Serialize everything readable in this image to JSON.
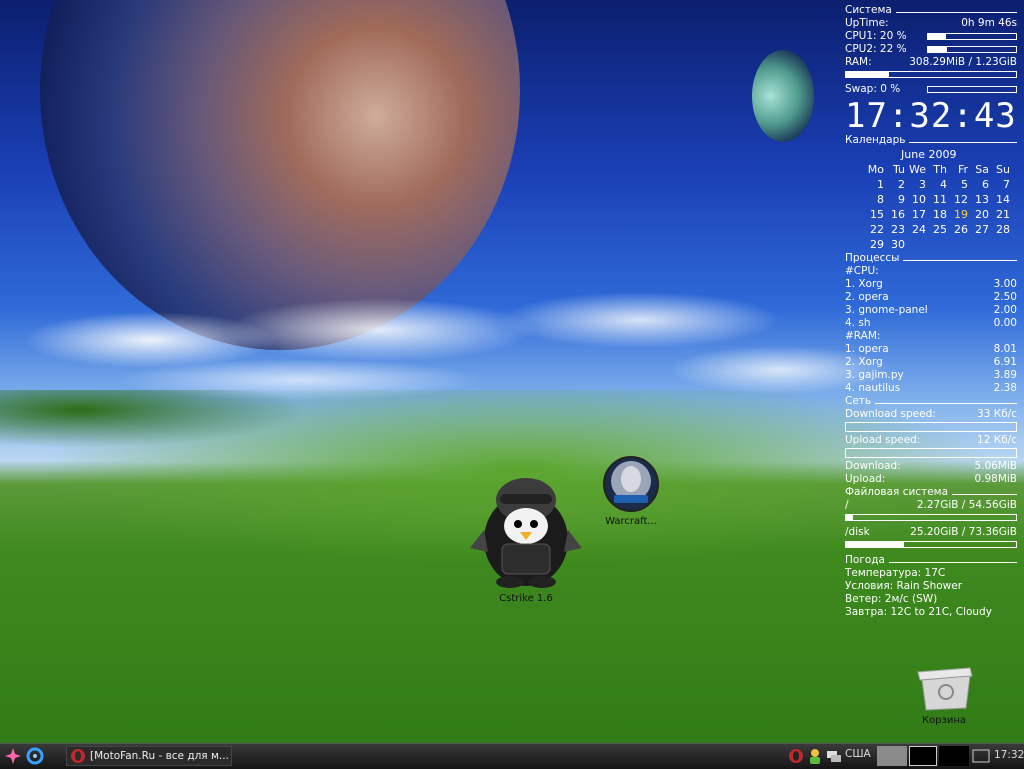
{
  "conky": {
    "system": {
      "title": "Система",
      "uptime_label": "UpTime:",
      "uptime_value": "0h 9m 46s",
      "cpu1_label": "CPU1: 20 %",
      "cpu1_percent": 20,
      "cpu2_label": "CPU2: 22 %",
      "cpu2_percent": 22,
      "ram_label": "RAM:",
      "ram_value": "308.29MiB / 1.23GiB",
      "ram_percent": 25,
      "swap_label": "Swap: 0  %",
      "swap_percent": 0
    },
    "clock": "17:32:43",
    "calendar": {
      "title": "Календарь",
      "month_year": "June   2009",
      "weekdays": [
        "Mo",
        "Tu",
        "We",
        "Th",
        "Fr",
        "Sa",
        "Su"
      ],
      "weeks": [
        [
          "1",
          "2",
          "3",
          "4",
          "5",
          "6",
          "7"
        ],
        [
          "8",
          "9",
          "10",
          "11",
          "12",
          "13",
          "14"
        ],
        [
          "15",
          "16",
          "17",
          "18",
          "19",
          "20",
          "21"
        ],
        [
          "22",
          "23",
          "24",
          "25",
          "26",
          "27",
          "28"
        ],
        [
          "29",
          "30",
          "",
          "",
          "",
          "",
          ""
        ]
      ],
      "today": "19"
    },
    "processes": {
      "title": "Процессы",
      "cpu_header": "#CPU:",
      "cpu": [
        {
          "name": "1. Xorg",
          "value": "3.00"
        },
        {
          "name": "2. opera",
          "value": "2.50"
        },
        {
          "name": "3. gnome-panel",
          "value": "2.00"
        },
        {
          "name": "4. sh",
          "value": "0.00"
        }
      ],
      "ram_header": "#RAM:",
      "ram": [
        {
          "name": "1. opera",
          "value": "8.01"
        },
        {
          "name": "2. Xorg",
          "value": "6.91"
        },
        {
          "name": "3. gajim.py",
          "value": "3.89"
        },
        {
          "name": "4. nautilus",
          "value": "2.38"
        }
      ]
    },
    "network": {
      "title": "Сеть",
      "down_label": "Download speed:",
      "down_value": "33   Кб/с",
      "up_label": "Upload speed:",
      "up_value": "12   Кб/с",
      "download_label": "Download:",
      "download_value": "5.06MiB",
      "upload_label": "Upload:",
      "upload_value": "0.98MiB"
    },
    "filesystem": {
      "title": "Файловая система",
      "root_label": "/",
      "root_value": "2.27GiB / 54.56GiB",
      "root_percent": 4,
      "disk_label": "/disk",
      "disk_value": "25.20GiB / 73.36GiB",
      "disk_percent": 34
    },
    "weather": {
      "title": "Погода",
      "temp": "Температура: 17C",
      "conditions": "Условия: Rain Shower",
      "wind": "Ветер:  2м/с (SW)",
      "tomorrow": "Завтра: 12C to 21C, Cloudy"
    }
  },
  "desktop": {
    "icons": {
      "cstrike": "Cstrike 1.6",
      "warcraft": "Warcraft...",
      "trash": "Корзина"
    }
  },
  "taskbar": {
    "task_title": "[MotoFan.Ru - все для м...",
    "language": "США",
    "clock": "17:32"
  }
}
